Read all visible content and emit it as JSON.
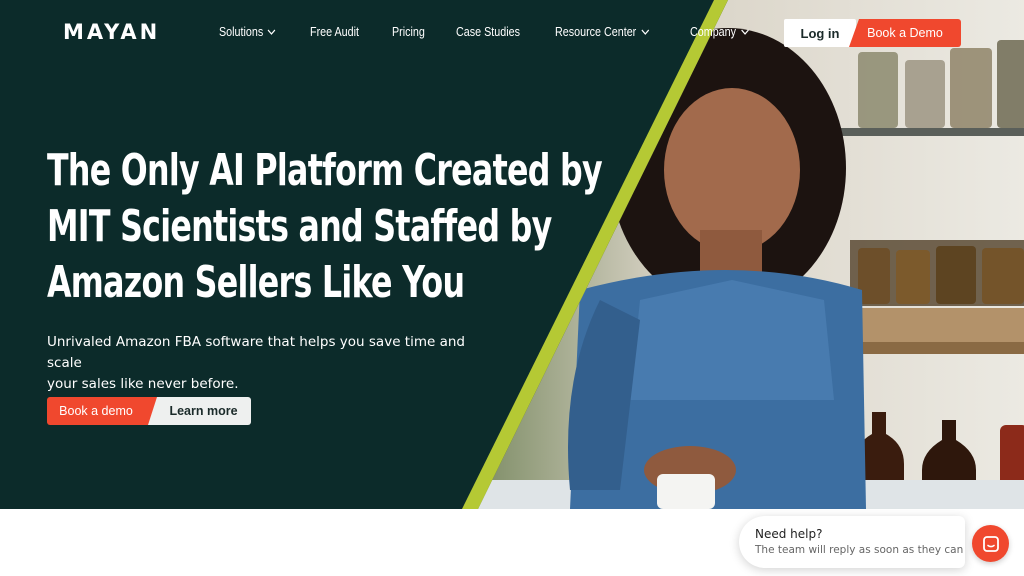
{
  "brand": {
    "logo_text": "MAYAN"
  },
  "nav": {
    "items": [
      {
        "label": "Solutions",
        "has_dropdown": true
      },
      {
        "label": "Free Audit",
        "has_dropdown": false
      },
      {
        "label": "Pricing",
        "has_dropdown": false
      },
      {
        "label": "Case Studies",
        "has_dropdown": false
      },
      {
        "label": "Resource Center",
        "has_dropdown": true
      },
      {
        "label": "Company",
        "has_dropdown": true
      }
    ],
    "login_label": "Log in",
    "book_demo_label": "Book a Demo"
  },
  "hero": {
    "headline_lines": [
      "The Only AI Platform Created by",
      "MIT Scientists and Staffed by",
      "Amazon Sellers Like You"
    ],
    "subtext_lines": [
      "Unrivaled Amazon FBA software that helps you save time and scale",
      "your sales like never before."
    ],
    "cta_primary": "Book a demo",
    "cta_secondary": "Learn more"
  },
  "chat": {
    "title": "Need help?",
    "subtitle": "The team will reply as soon as they can",
    "launcher_icon": "chat-icon"
  },
  "colors": {
    "hero_bg": "#0c2b2a",
    "accent_orange": "#f0482e",
    "accent_lime": "#b5c934",
    "button_light": "#eef0ef"
  }
}
